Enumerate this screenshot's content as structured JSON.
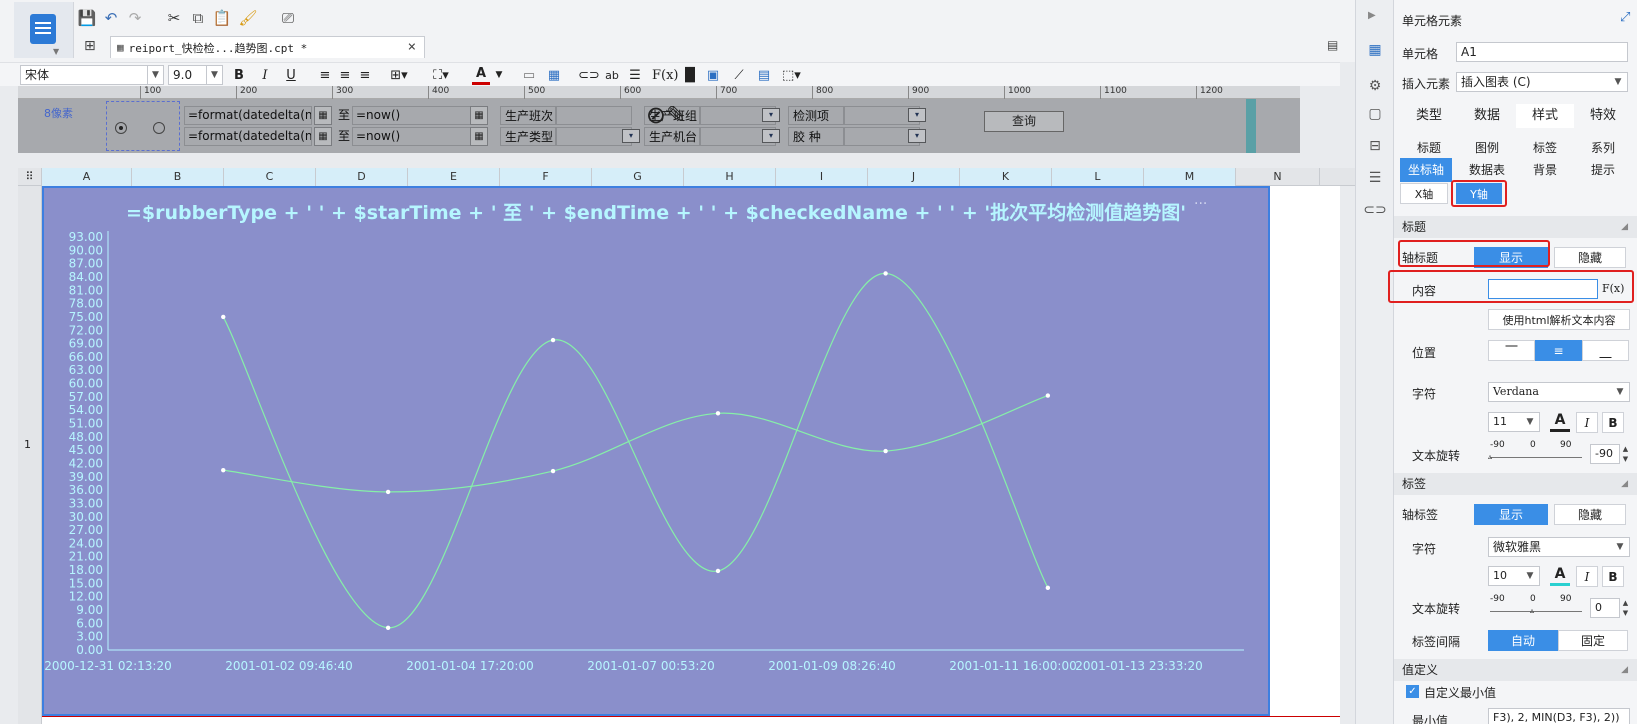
{
  "document_tab": {
    "label": "reiport_快检检...趋势图.cpt *"
  },
  "format_bar": {
    "font": "宋体",
    "size": "9.0"
  },
  "ruler": {
    "labels": [
      "100",
      "200",
      "300",
      "400",
      "500",
      "600",
      "700",
      "800",
      "900",
      "1000",
      "1100",
      "1200"
    ]
  },
  "param_pane": {
    "pixel_label": "8像素",
    "start_formula": "=format(datedelta(now",
    "end_formula": "=format(datedelta(now",
    "to_label": "至",
    "now_formula": "=now()",
    "labels": [
      "生产班次",
      "生产班组",
      "检测项",
      "生产类型",
      "生产机台",
      "胶  种"
    ],
    "query_button": "查询"
  },
  "columns": [
    "A",
    "B",
    "C",
    "D",
    "E",
    "F",
    "G",
    "H",
    "I",
    "J",
    "K",
    "L",
    "M",
    "N"
  ],
  "rows": [
    "1"
  ],
  "colors": {
    "chart_bg": "#8a8fcb",
    "line": "#86f0a8",
    "label": "#b6f6ff",
    "accent": "#3a8ee6",
    "highlight": "#e0201f"
  },
  "chart_data": {
    "type": "line",
    "title": "=$rubberType + ' ' + $starTime + ' 至 ' + $endTime + ' ' + $checkedName + ' ' + '批次平均检测值趋势图'",
    "xlabel": "",
    "ylabel": "",
    "ylim": [
      0,
      93
    ],
    "y_ticks": [
      "0.00",
      "3.00",
      "6.00",
      "9.00",
      "12.00",
      "15.00",
      "18.00",
      "21.00",
      "24.00",
      "27.00",
      "30.00",
      "33.00",
      "36.00",
      "39.00",
      "42.00",
      "45.00",
      "48.00",
      "51.00",
      "54.00",
      "57.00",
      "60.00",
      "63.00",
      "66.00",
      "69.00",
      "72.00",
      "75.00",
      "78.00",
      "81.00",
      "84.00",
      "87.00",
      "90.00",
      "93.00"
    ],
    "x_ticks": [
      "2000-12-31 02:13:20",
      "2001-01-02 09:46:40",
      "2001-01-04 17:20:00",
      "2001-01-07 00:53:20",
      "2001-01-09 08:26:40",
      "2001-01-11 16:00:00",
      "2001-01-13 23:33:20"
    ],
    "x_range_hours": [
      0,
      1333.33
    ],
    "grid": false,
    "series": [
      {
        "points": [
          [
            141.5,
            75.0
          ],
          [
            343.9,
            5.0
          ],
          [
            546.4,
            69.8
          ],
          [
            748.9,
            17.8
          ],
          [
            954.7,
            84.8
          ],
          [
            1153.9,
            14.0
          ]
        ]
      },
      {
        "points": [
          [
            141.5,
            40.5
          ],
          [
            343.9,
            35.6
          ],
          [
            546.4,
            40.3
          ],
          [
            748.9,
            53.3
          ],
          [
            954.7,
            44.8
          ],
          [
            1153.9,
            57.3
          ]
        ]
      }
    ]
  },
  "icon_strip": {
    "icons": [
      "cell-element-icon",
      "template-icon",
      "widget-icon",
      "chart-icon",
      "datasource-icon",
      "link-icon"
    ]
  },
  "panel": {
    "header": "单元格元素",
    "cell_label": "单元格",
    "cell_value": "A1",
    "insert_label": "插入元素",
    "insert_value": "插入图表 (C)",
    "tabs": [
      "类型",
      "数据",
      "样式",
      "特效"
    ],
    "subtabs_row1": [
      "标题",
      "图例",
      "标签",
      "系列"
    ],
    "subtabs_row2": [
      "坐标轴",
      "数据表",
      "背景",
      "提示"
    ],
    "axis_tabs": [
      "X轴",
      "Y轴"
    ],
    "section_title": "标题",
    "axis_title_label": "轴标题",
    "show": "显示",
    "hide": "隐藏",
    "content_label": "内容",
    "content_value": "",
    "fx": "F(x)",
    "html_btn": "使用html解析文本内容",
    "position_label": "位置",
    "font_label": "字符",
    "font_value": "Verdana",
    "font_size": "11",
    "rotate_label": "文本旋转",
    "rotate_marks": [
      "-90",
      "0",
      "90"
    ],
    "rotate_value": "-90",
    "section_label": "标签",
    "axis_label_label": "轴标签",
    "label_font": "微软雅黑",
    "label_font_size": "10",
    "label_rotate_value": "0",
    "interval_label": "标签间隔",
    "auto": "自动",
    "fixed": "固定",
    "section_value": "值定义",
    "custom_min": "自定义最小值",
    "min_label": "最小值",
    "min_value": "F3), 2, MIN(D3, F3), 2))"
  }
}
